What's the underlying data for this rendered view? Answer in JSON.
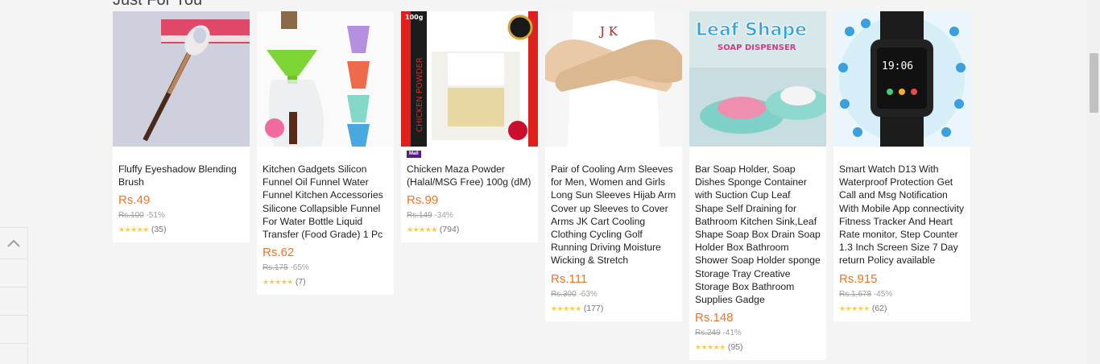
{
  "section": {
    "title": "Just For You"
  },
  "products": [
    {
      "title": "Fluffy Eyeshadow Blending Brush",
      "price": "Rs.49",
      "original": "Rs.100",
      "discount": "-51%",
      "stars": "★★★★★",
      "reviews": "(35)",
      "mall": ""
    },
    {
      "title": "Kitchen Gadgets Silicon Funnel Oil Funnel Water Funnel Kitchen Accessories Silicone Collapsible Funnel For Water Bottle Liquid Transfer (Food Grade) 1 Pc",
      "price": "Rs.62",
      "original": "Rs.175",
      "discount": "-65%",
      "stars": "★★★★★",
      "reviews": "(7)",
      "mall": ""
    },
    {
      "title": "Chicken Maza Powder (Halal/MSG Free) 100g (dM)",
      "price": "Rs.99",
      "original": "Rs.149",
      "discount": "-34%",
      "stars": "★★★★★",
      "reviews": "(794)",
      "mall": "Mall"
    },
    {
      "title": "Pair of Cooling Arm Sleeves for Men, Women and Girls Long Sun Sleeves Hijab Arm Cover up Sleeves to Cover Arms JK Cart Cooling Clothing Cycling Golf Running Driving Moisture Wicking & Stretch",
      "price": "Rs.111",
      "original": "Rs.300",
      "discount": "-63%",
      "stars": "★★★★★",
      "reviews": "(177)",
      "mall": ""
    },
    {
      "title": "Bar Soap Holder, Soap Dishes Sponge Container with Suction Cup Leaf Shape Self Draining for Bathroom Kitchen Sink,Leaf Shape Soap Box Drain Soap Holder Box Bathroom Shower Soap Holder sponge Storage Tray Creative Storage Box Bathroom Supplies Gadge",
      "price": "Rs.148",
      "original": "Rs.249",
      "discount": "-41%",
      "stars": "★★★★★",
      "reviews": "(95)",
      "mall": ""
    },
    {
      "title": "Smart Watch D13 With Waterproof Protection Get Call and Msg Notification With Mobile App connectivity Fitness Tracker And Heart Rate monitor, Step Counter 1.3 Inch Screen Size 7 Day return Policy available",
      "price": "Rs.915",
      "original": "Rs.1,678",
      "discount": "-45%",
      "stars": "★★★★★",
      "reviews": "(62)",
      "mall": ""
    }
  ],
  "images": {
    "chicken": {
      "brand": "100g",
      "label": "CHICKEN POWDER"
    },
    "sleeves": {
      "logo": "J  K"
    },
    "soap": {
      "headline": "Leaf Shape",
      "sub": "SOAP DISPENSER"
    },
    "watch": {
      "time": "19:06"
    }
  },
  "colors": {
    "price": "#f57224",
    "star": "#faca51",
    "mall": "#5a1a8a"
  }
}
